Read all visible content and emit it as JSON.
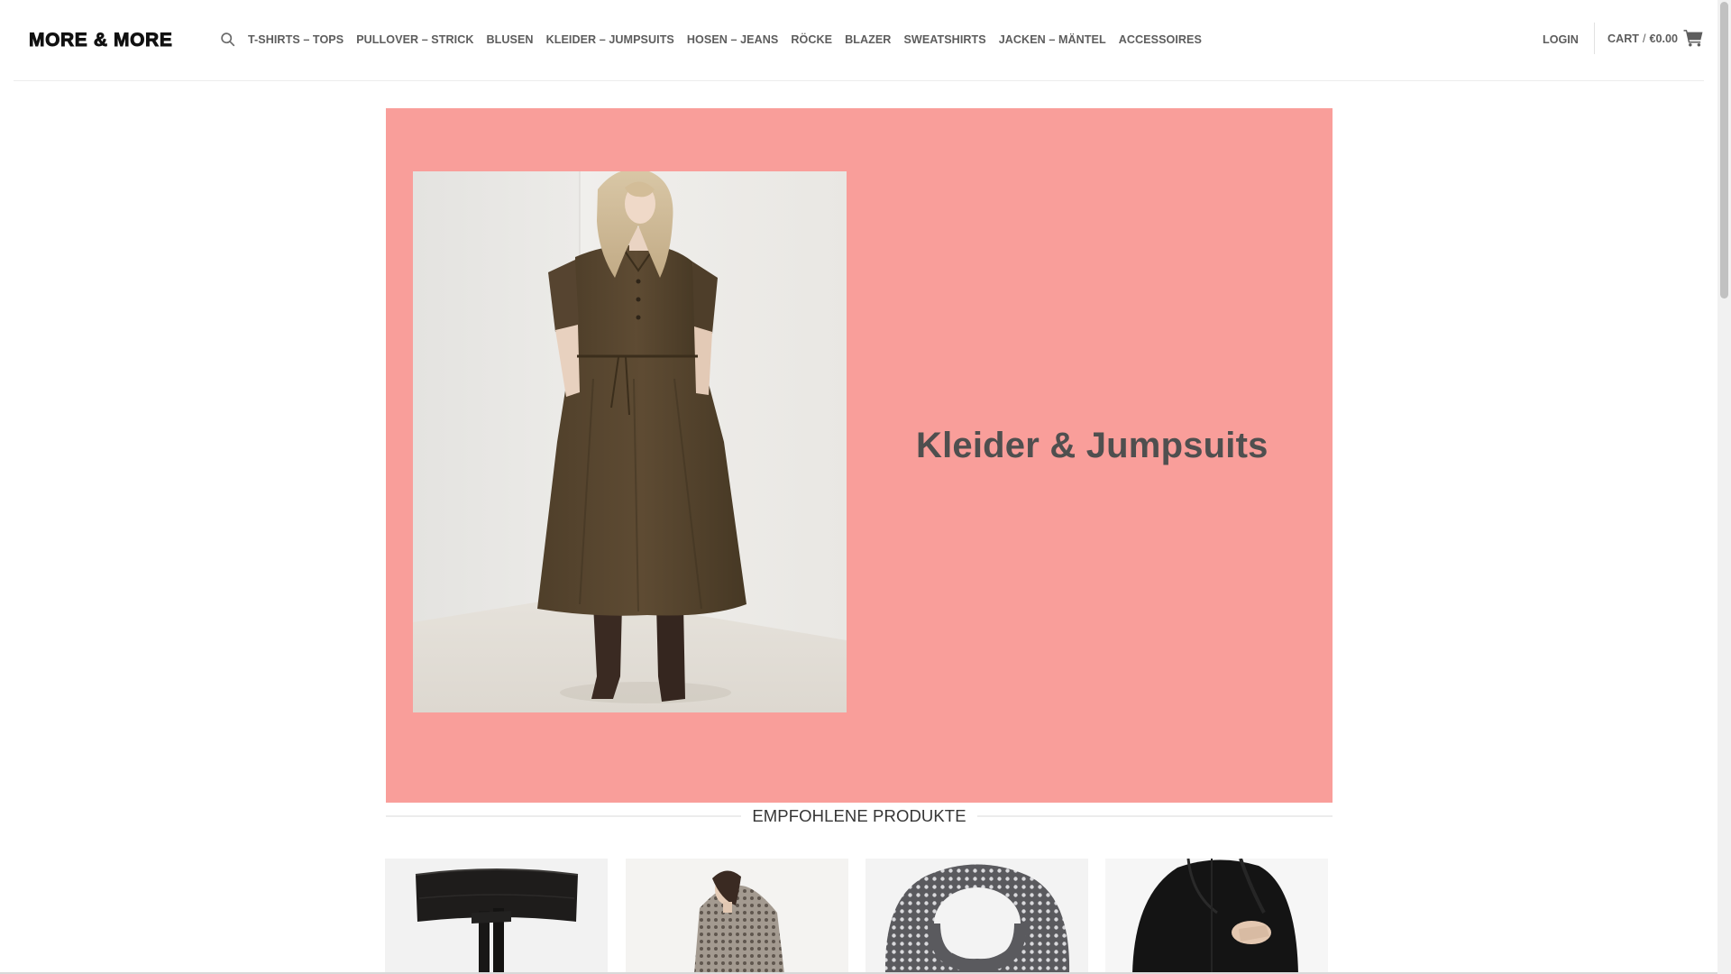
{
  "brand": {
    "logo_text": "MORE & MORE"
  },
  "header": {
    "search_icon": "search-icon",
    "nav": [
      {
        "label": "T-SHIRTS – TOPS"
      },
      {
        "label": "PULLOVER – STRICK"
      },
      {
        "label": "BLUSEN"
      },
      {
        "label": "KLEIDER – JUMPSUITS"
      },
      {
        "label": "HOSEN – JEANS"
      },
      {
        "label": "RÖCKE"
      },
      {
        "label": "BLAZER"
      },
      {
        "label": "SWEATSHIRTS"
      },
      {
        "label": "JACKEN – MÄNTEL"
      },
      {
        "label": "ACCESSOIRES"
      }
    ],
    "login_label": "LOGIN",
    "cart_label": "CART",
    "cart_separator": "/",
    "cart_total": "€0.00",
    "cart_icon": "shopping-cart-icon"
  },
  "banner": {
    "title": "Kleider & Jumpsuits",
    "background_color": "#f99e9a",
    "image": "woman-in-brown-midi-dress-photo"
  },
  "featured": {
    "title": "EMPFOHLENE PRODUKTE",
    "products": [
      {
        "image": "black-leather-wrap-belt-photo"
      },
      {
        "image": "woman-in-patterned-knit-cardigan-photo"
      },
      {
        "image": "grey-patterned-scarf-photo"
      },
      {
        "image": "woman-in-black-coat-with-bag-photo"
      }
    ]
  },
  "colors": {
    "nav_text": "#5d5d5d",
    "title_text": "#4f4f4f"
  }
}
